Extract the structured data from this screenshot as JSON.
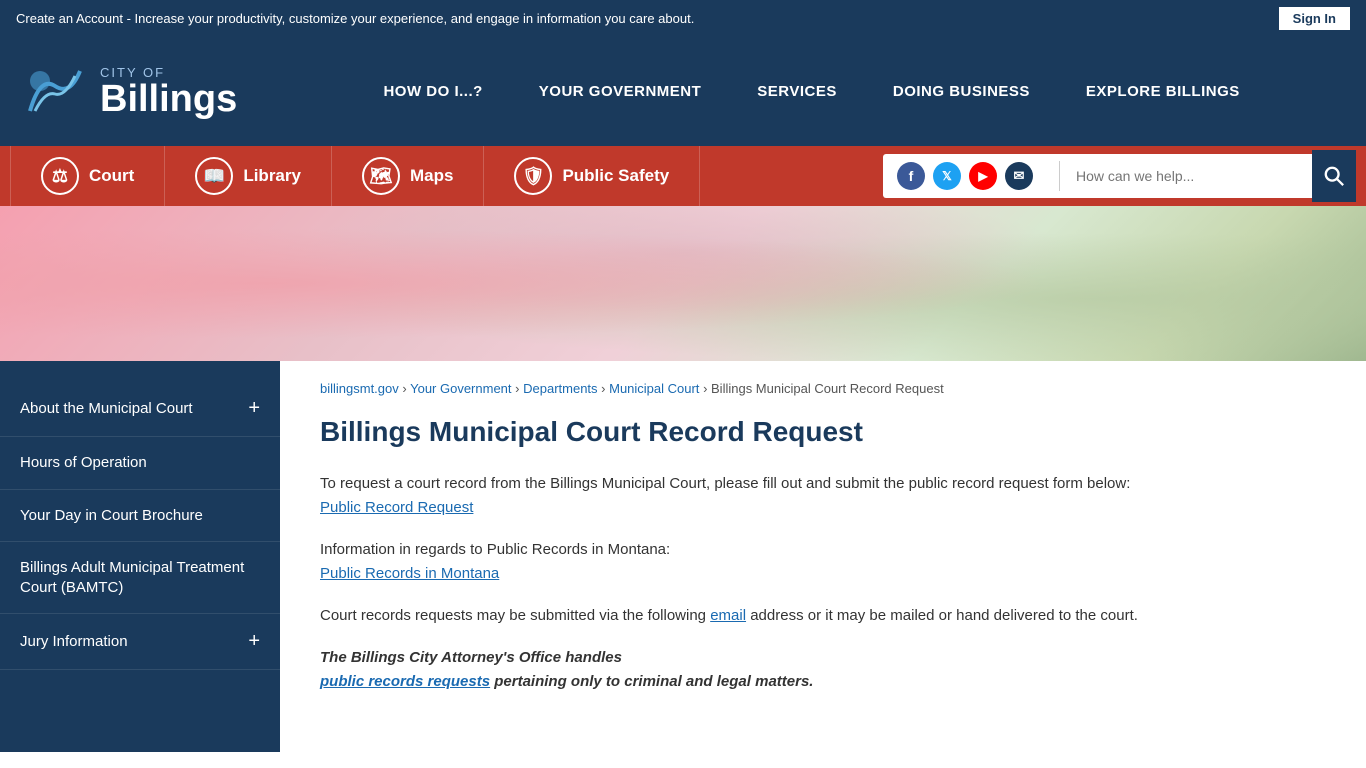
{
  "topbar": {
    "message": "Create an Account - Increase your productivity, customize your experience, and engage in information you care about.",
    "signin_label": "Sign In"
  },
  "header": {
    "logo": {
      "city_of": "CITY OF",
      "billings": "Billings"
    },
    "nav": [
      {
        "label": "HOW DO I...?"
      },
      {
        "label": "YOUR GOVERNMENT"
      },
      {
        "label": "SERVICES"
      },
      {
        "label": "DOING BUSINESS"
      },
      {
        "label": "EXPLORE BILLINGS"
      }
    ]
  },
  "quickbar": {
    "items": [
      {
        "icon": "⚖",
        "label": "Court"
      },
      {
        "icon": "📖",
        "label": "Library"
      },
      {
        "icon": "🗺",
        "label": "Maps"
      },
      {
        "icon": "🛡",
        "label": "Public Safety"
      }
    ],
    "search_placeholder": "How can we help...",
    "social": [
      {
        "name": "Facebook",
        "symbol": "f",
        "class": "social-fb"
      },
      {
        "name": "Twitter",
        "symbol": "𝕏",
        "class": "social-tw"
      },
      {
        "name": "YouTube",
        "symbol": "▶",
        "class": "social-yt"
      },
      {
        "name": "Email",
        "symbol": "✉",
        "class": "social-em"
      }
    ]
  },
  "breadcrumb": {
    "items": [
      {
        "label": "billingsmt.gov",
        "href": "#"
      },
      {
        "label": "Your Government",
        "href": "#"
      },
      {
        "label": "Departments",
        "href": "#"
      },
      {
        "label": "Municipal Court",
        "href": "#"
      },
      {
        "label": "Billings Municipal Court Record Request",
        "href": "#"
      }
    ],
    "separator": "›"
  },
  "sidebar": {
    "items": [
      {
        "label": "About the Municipal Court",
        "has_plus": true
      },
      {
        "label": "Hours of Operation",
        "has_plus": false
      },
      {
        "label": "Your Day in Court Brochure",
        "has_plus": false
      },
      {
        "label": "Billings Adult Municipal Treatment Court (BAMTC)",
        "has_plus": false
      },
      {
        "label": "Jury Information",
        "has_plus": true
      }
    ]
  },
  "main": {
    "title": "Billings Municipal Court Record Request",
    "paragraphs": [
      {
        "type": "text_with_link",
        "text_before": "To request a court record from the Billings Municipal Court, please fill out and submit the public record request form below:",
        "link_text": "Public Record Request",
        "link_href": "#"
      },
      {
        "type": "text_with_link",
        "text_before": "Information in regards to Public Records in Montana:",
        "link_text": "Public Records in Montana",
        "link_href": "#"
      },
      {
        "type": "text_with_link",
        "text_before": "Court records requests may be submitted via the following",
        "link_text": "email",
        "text_after": " address or it may be mailed or hand delivered to the court.",
        "link_href": "#"
      },
      {
        "type": "bold_italic",
        "text": "The Billings City Attorney's Office handles",
        "link_text": "public records requests",
        "text_after": " pertaining only to criminal and legal matters."
      }
    ]
  }
}
